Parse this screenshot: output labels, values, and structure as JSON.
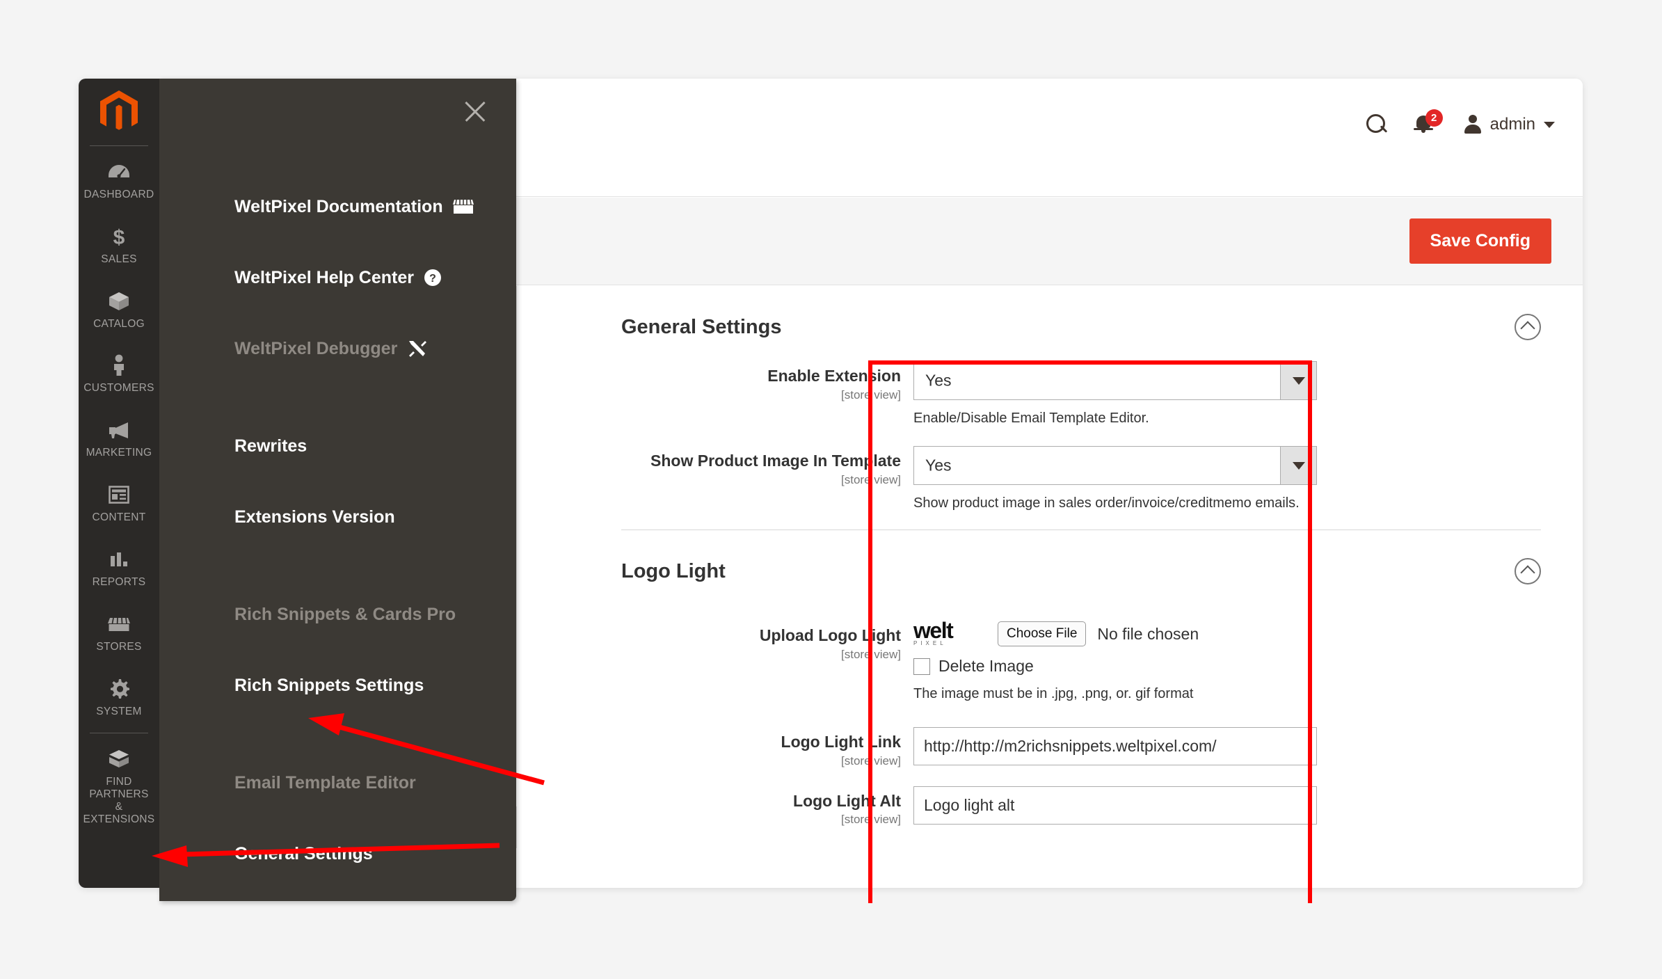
{
  "topbar": {
    "search_icon": "search-icon",
    "notifications_icon": "bell-icon",
    "notifications_count": "2",
    "user_icon": "avatar-icon",
    "user_name": "admin",
    "caret_icon": "chevron-down-icon"
  },
  "page_actions": {
    "help_icon_label": "?",
    "save_label": "Save Config"
  },
  "nav_rail": {
    "logo_icon": "magento-logo-icon",
    "items": [
      {
        "label": "DASHBOARD",
        "icon": "gauge-icon"
      },
      {
        "label": "SALES",
        "icon": "dollar-icon"
      },
      {
        "label": "CATALOG",
        "icon": "box-icon"
      },
      {
        "label": "CUSTOMERS",
        "icon": "person-icon"
      },
      {
        "label": "MARKETING",
        "icon": "megaphone-icon"
      },
      {
        "label": "CONTENT",
        "icon": "layout-icon"
      },
      {
        "label": "REPORTS",
        "icon": "bar-chart-icon"
      },
      {
        "label": "STORES",
        "icon": "storefront-icon"
      },
      {
        "label": "SYSTEM",
        "icon": "gear-icon"
      },
      {
        "label": "FIND PARTNERS\n& EXTENSIONS",
        "icon": "extensions-icon"
      }
    ]
  },
  "flyout": {
    "close_icon": "close-icon",
    "items": [
      {
        "label": "WeltPixel Documentation",
        "icon": "storefront-icon",
        "type": "link"
      },
      {
        "label": "WeltPixel Help Center",
        "icon": "question-circle-icon",
        "type": "link"
      },
      {
        "label": "WeltPixel Debugger",
        "icon": "tools-icon",
        "type": "group"
      },
      {
        "label": "Rewrites",
        "icon": "",
        "type": "link"
      },
      {
        "label": "Extensions Version",
        "icon": "",
        "type": "link"
      },
      {
        "label": "Rich Snippets & Cards Pro",
        "icon": "",
        "type": "group"
      },
      {
        "label": "Rich Snippets Settings",
        "icon": "",
        "type": "link"
      },
      {
        "label": "Email Template Editor",
        "icon": "",
        "type": "group"
      },
      {
        "label": "General Settings",
        "icon": "",
        "type": "link"
      }
    ]
  },
  "config_nav": {
    "collapsed_chevron": "chevron-down-icon",
    "expanded_chevron": "chevron-up-icon",
    "rows": [
      {
        "state": "collapsed"
      },
      {
        "state": "collapsed"
      },
      {
        "state": "collapsed"
      },
      {
        "state": "collapsed"
      },
      {
        "state": "collapsed"
      },
      {
        "state": "expanded"
      }
    ]
  },
  "sections": [
    {
      "title": "General Settings",
      "collapse_icon": "chevron-up-circle-icon",
      "fields": [
        {
          "label": "Enable Extension",
          "scope": "[store view]",
          "control": "select",
          "value": "Yes",
          "note": "Enable/Disable Email Template Editor."
        },
        {
          "label": "Show Product Image In Template",
          "scope": "[store view]",
          "control": "select",
          "value": "Yes",
          "note": "Show product image in sales order/invoice/creditmemo emails."
        }
      ]
    },
    {
      "title": "Logo Light",
      "collapse_icon": "chevron-up-circle-icon",
      "fields": [
        {
          "label": "Upload Logo Light",
          "scope": "[store view]",
          "control": "file",
          "preview_logo_main": "welt",
          "preview_logo_sub": "PIXEL",
          "choose_file_label": "Choose File",
          "no_file_label": "No file chosen",
          "delete_label": "Delete Image",
          "note": "The image must be in .jpg, .png, or. gif format"
        },
        {
          "label": "Logo Light Link",
          "scope": "[store view]",
          "control": "text",
          "value": "http://http://m2richsnippets.weltpixel.com/"
        },
        {
          "label": "Logo Light Alt",
          "scope": "[store view]",
          "control": "text",
          "value": "Logo light alt"
        }
      ]
    }
  ],
  "annotations": {
    "highlight_color": "#ff0000",
    "arrow_color": "#ff0000",
    "arrow_count": 2
  }
}
